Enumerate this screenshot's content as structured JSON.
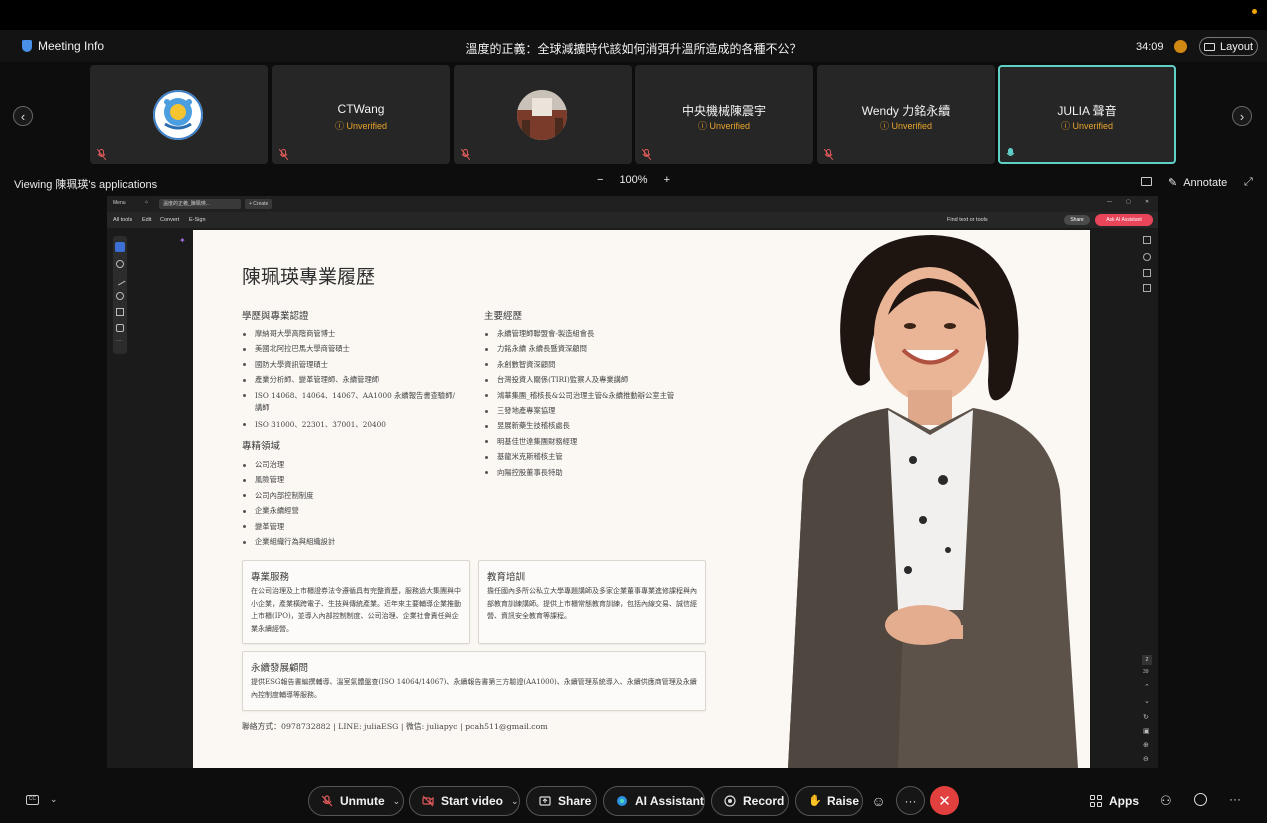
{
  "header": {
    "meeting_info_label": "Meeting Info",
    "meeting_title": "溫度的正義：全球減擴時代該如何消弭升溫所造成的各種不公？",
    "timer": "34:09",
    "layout_label": "Layout"
  },
  "participants": [
    {
      "name": "",
      "status": "",
      "avatar": "logo",
      "muted": true,
      "active": false
    },
    {
      "name": "CTWang",
      "status": "Unverified",
      "muted": true,
      "active": false
    },
    {
      "name": "",
      "status": "",
      "avatar": "photo",
      "muted": true,
      "active": false
    },
    {
      "name": "中央機械陳震宇",
      "status": "Unverified",
      "muted": true,
      "active": false
    },
    {
      "name": "Wendy 力銘永續",
      "status": "Unverified",
      "muted": true,
      "active": false
    },
    {
      "name": "JULIA 聲音",
      "status": "Unverified",
      "muted": false,
      "active": true
    }
  ],
  "viewing": {
    "label": "Viewing 陳珮瑛's applications",
    "zoom": "100%",
    "minus": "−",
    "plus": "+",
    "annotate_label": "Annotate"
  },
  "acrobat": {
    "menu": "Menu",
    "tab": "溫度的正義_陳珮瑛...",
    "create": "+ Create",
    "menus": [
      "All tools",
      "Edit",
      "Convert",
      "E-Sign"
    ],
    "find": "Find text or tools",
    "share": "Share",
    "ai": "Ask AI Assistant",
    "page_num": "2",
    "page_total": "39"
  },
  "document": {
    "title": "陳珮瑛專業履歷",
    "edu_heading": "學歷與專業認證",
    "edu_items": [
      "摩納哥大學高階商管博士",
      "美國北阿拉巴馬大學商管碩士",
      "國防大學資訊管理碩士",
      "產業分析師、變革管理師、永續管理師",
      "ISO 14068、14064、14067、AA1000 永續報告書查驗師/",
      "講師",
      "ISO 31000、22301、37001、20400"
    ],
    "exp_heading": "主要經歷",
    "exp_items": [
      "永續管理師聯盟會-製造組會長",
      "力銘永續 永續長暨資深顧問",
      "永創數智資深顧問",
      "台灣投資人關係(TIRI)監察人及專業講師",
      "鴻華集團_稽核長&公司治理主管&永續推動辦公室主管",
      "三發地產專案協理",
      "昱展新藥生技稽核處長",
      "明基佳世達集團財務經理",
      "基龍米克斯稽核主管",
      "向陽控股董事長特助"
    ],
    "spec_heading": "專精領域",
    "spec_items": [
      "公司治理",
      "風險管理",
      "公司內部控制制度",
      "企業永續經營",
      "變革管理",
      "企業組織行為與組織設計"
    ],
    "services_title": "專業服務",
    "services_body": "在公司治理及上市櫃證券法令遵循具有完整資歷，服務過大集團與中小企業，產業橫跨電子、生技與傳統產業。近年來主要輔導企業推動上市櫃(IPO)，並導入內部控制制度、公司治理、企業社會責任與企業永續經營。",
    "training_title": "教育培訓",
    "training_body": "擔任國內多所公私立大學專題講師及多家企業董事專業進修課程與內部教育訓練講師。提供上市櫃常態教育訓練，包括內線交易、誠信經營、資訊安全教育等課程。",
    "esg_title": "永續發展顧問",
    "esg_body": "提供ESG報告書編撰輔導、溫室氣體盤查(ISO 14064/14067)、永續報告書第三方驗證(AA1000)、永續管理系統導入、永續供應商管理及永續內控制度輔導等服務。",
    "contact": "聯絡方式：0978732882 | LINE: juliaESG | 微信: juliapyc | pcah511@gmail.com"
  },
  "toolbar": {
    "unmute": "Unmute",
    "start_video": "Start video",
    "share": "Share",
    "ai_assistant": "AI Assistant",
    "record": "Record",
    "raise": "Raise",
    "apps": "Apps"
  },
  "colors": {
    "accent_teal": "#5fd0c8",
    "unverified": "#e8a52a",
    "end_red": "#e23f3f",
    "ai_pink": "#e8445a"
  }
}
